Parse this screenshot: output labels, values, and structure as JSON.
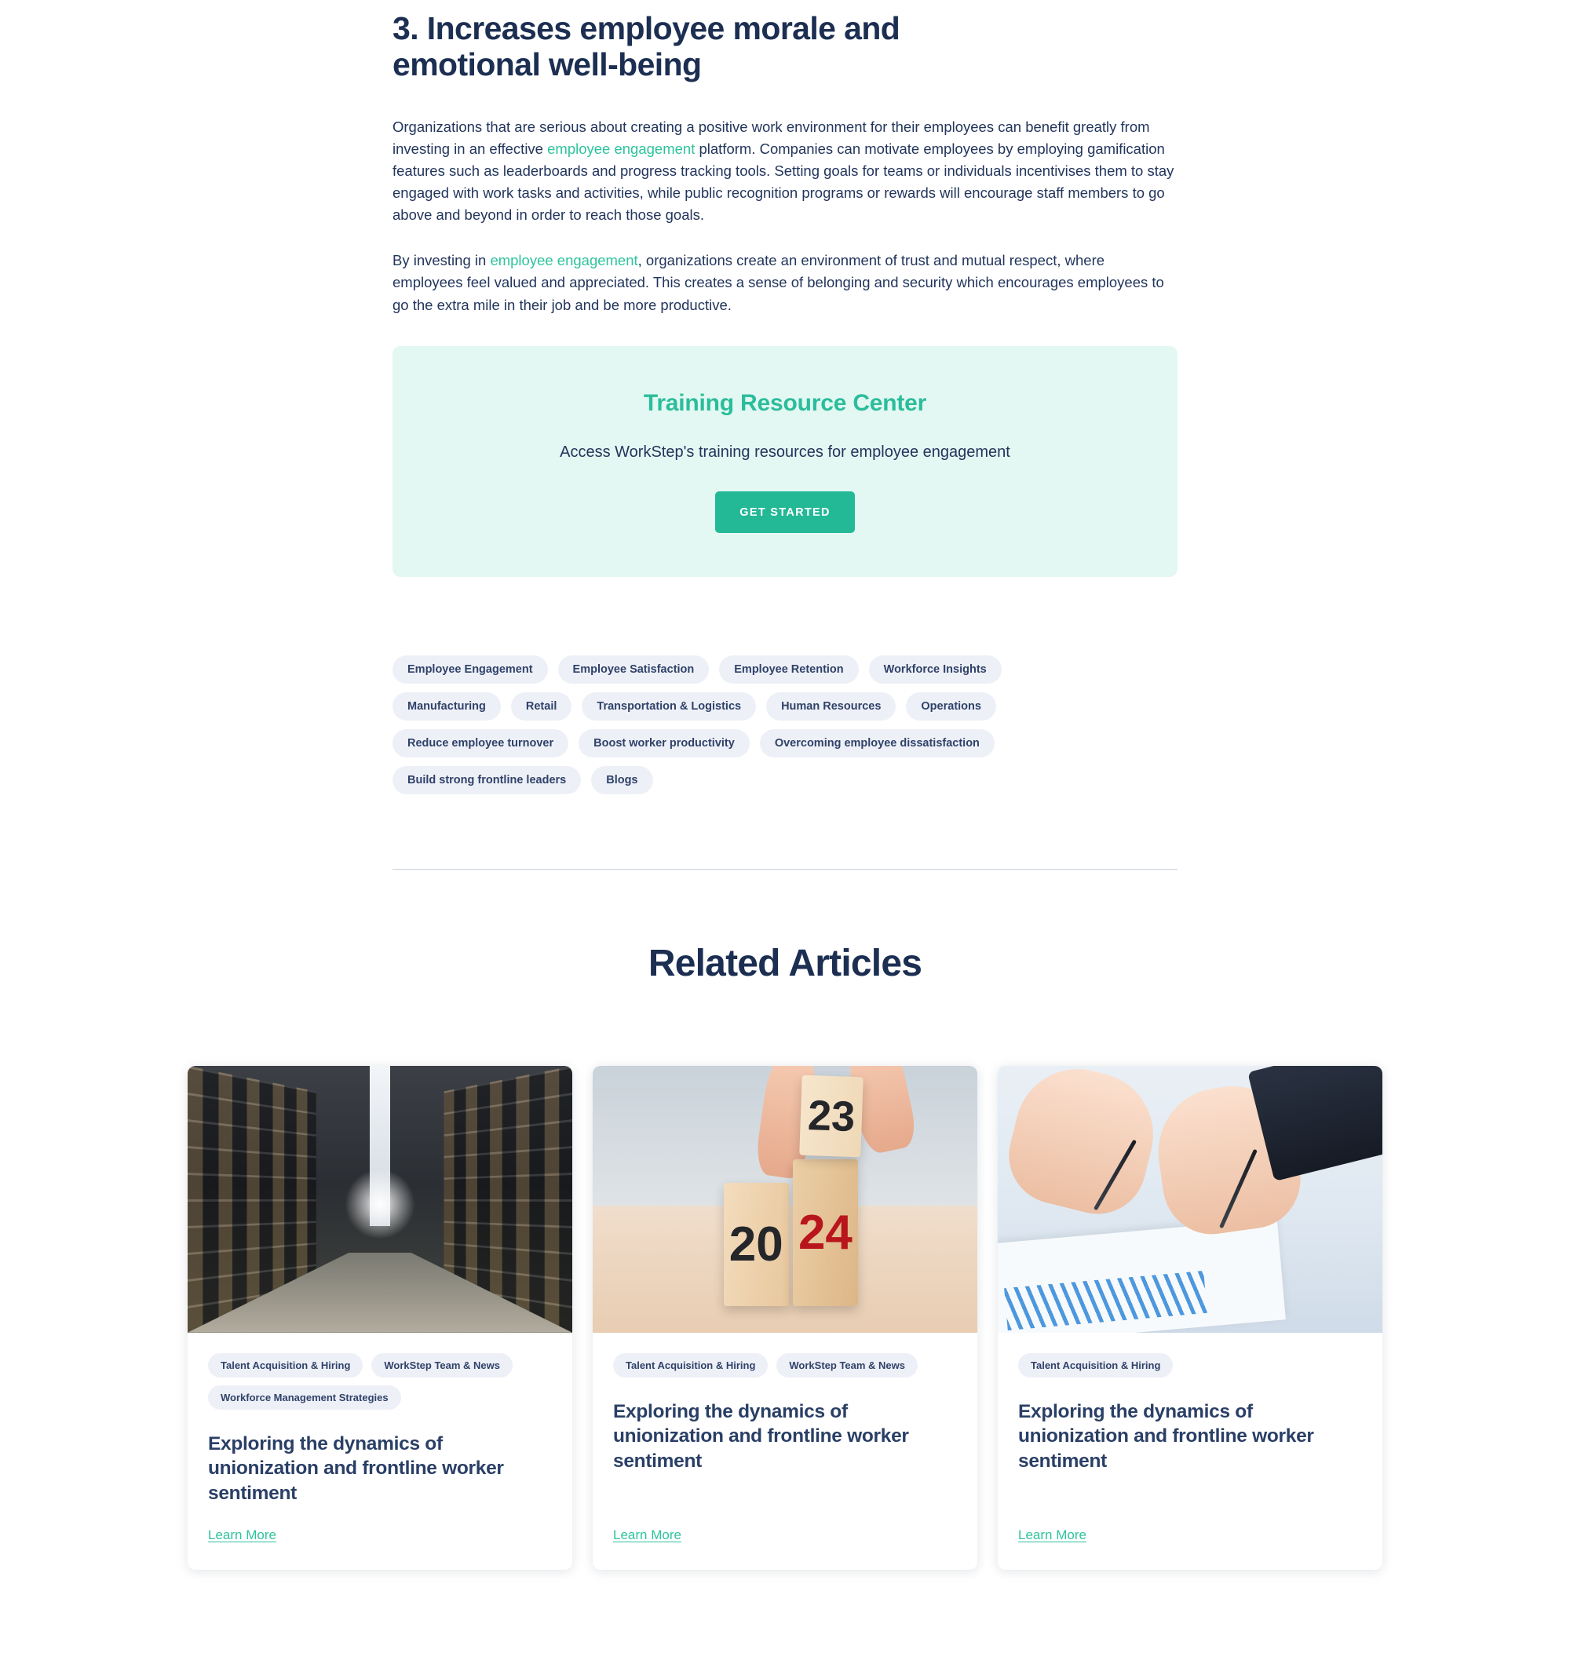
{
  "article": {
    "heading": "3. Increases employee morale and emotional well-being",
    "paragraph1": {
      "part1": "Organizations that are serious about creating a positive work environment for their employees can benefit greatly from investing in an effective ",
      "link": "employee engagement",
      "part2": " platform. Companies can motivate employees by employing gamification features such as leaderboards and progress tracking tools. Setting goals for teams or individuals incentivises them to stay engaged with work tasks and activities, while public recognition programs or rewards will encourage staff members to go above and beyond in order to reach those goals."
    },
    "paragraph2": {
      "part1": "By investing in ",
      "link": "employee engagement",
      "part2": ", organizations create an environment of trust and mutual respect, where employees feel valued and appreciated. This creates a sense of belonging and security which encourages employees to go the extra mile in their job and be more productive."
    }
  },
  "cta": {
    "title": "Training Resource Center",
    "subtitle": "Access WorkStep's training resources for employee engagement",
    "button_label": "GET STARTED"
  },
  "tags": [
    "Employee Engagement",
    "Employee Satisfaction",
    "Employee Retention",
    "Workforce Insights",
    "Manufacturing",
    "Retail",
    "Transportation & Logistics",
    "Human Resources",
    "Operations",
    "Reduce employee turnover",
    "Boost worker productivity",
    "Overcoming employee dissatisfaction",
    "Build strong frontline leaders",
    "Blogs"
  ],
  "related": {
    "title": "Related Articles",
    "cards": [
      {
        "image_name": "warehouse-aisle-image",
        "tags": [
          "Talent Acquisition & Hiring",
          "WorkStep Team & News",
          "Workforce Management Strategies"
        ],
        "title": "Exploring the dynamics of unionization and frontline worker sentiment",
        "link_label": "Learn More"
      },
      {
        "image_name": "year-blocks-2023-2024-image",
        "tags": [
          "Talent Acquisition & Hiring",
          "WorkStep Team & News"
        ],
        "title": "Exploring the dynamics of unionization and frontline worker sentiment",
        "link_label": "Learn More"
      },
      {
        "image_name": "hands-signing-documents-image",
        "tags": [
          "Talent Acquisition & Hiring"
        ],
        "title": "Exploring the dynamics of unionization and frontline worker sentiment",
        "link_label": "Learn More"
      }
    ]
  },
  "colors": {
    "navy": "#1c2f52",
    "body_navy": "#22355c",
    "accent_green": "#2ec39d",
    "cta_green": "#23b896",
    "cta_bg": "#e3f8f2",
    "tag_bg": "#eef0f7",
    "tag_text": "#2f4269",
    "divider": "#ccd3de"
  }
}
